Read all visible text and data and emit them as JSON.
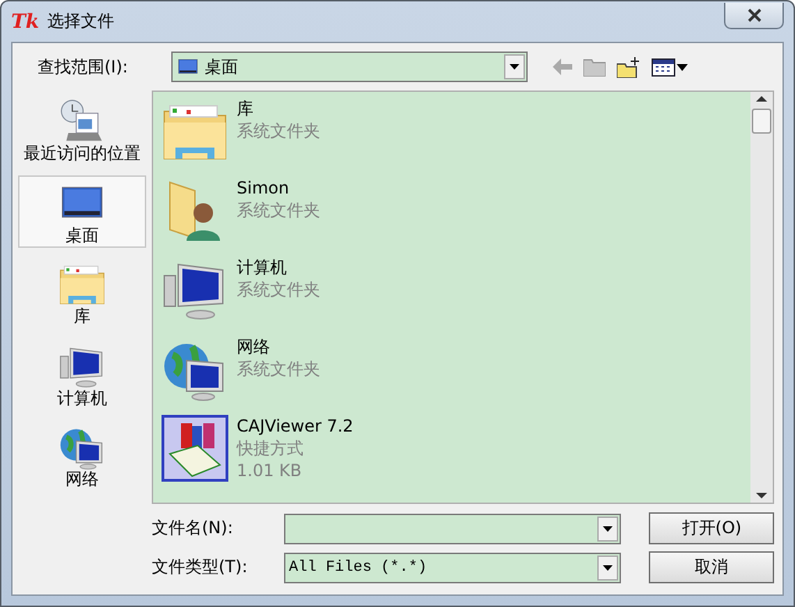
{
  "window": {
    "logo": "Tk",
    "title": "选择文件"
  },
  "look_in": {
    "label": "查找范围(I):",
    "value": "桌面"
  },
  "sidebar": {
    "items": [
      {
        "label": "最近访问的位置",
        "kind": "recent",
        "selected": false
      },
      {
        "label": "桌面",
        "kind": "desktop",
        "selected": true
      },
      {
        "label": "库",
        "kind": "library",
        "selected": false
      },
      {
        "label": "计算机",
        "kind": "computer",
        "selected": false
      },
      {
        "label": "网络",
        "kind": "network",
        "selected": false
      }
    ]
  },
  "files": [
    {
      "name": "库",
      "kind": "library",
      "details": [
        "系统文件夹"
      ]
    },
    {
      "name": "Simon",
      "kind": "user",
      "details": [
        "系统文件夹"
      ]
    },
    {
      "name": "计算机",
      "kind": "computer",
      "details": [
        "系统文件夹"
      ]
    },
    {
      "name": "网络",
      "kind": "network",
      "details": [
        "系统文件夹"
      ]
    },
    {
      "name": "CAJViewer 7.2",
      "kind": "shortcut",
      "details": [
        "快捷方式",
        "1.01 KB"
      ]
    }
  ],
  "file_name": {
    "label": "文件名(N):"
  },
  "file_type": {
    "label": "文件类型(T):",
    "value": "All Files (*.*)"
  },
  "buttons": [
    "打开(O)",
    "取消"
  ]
}
